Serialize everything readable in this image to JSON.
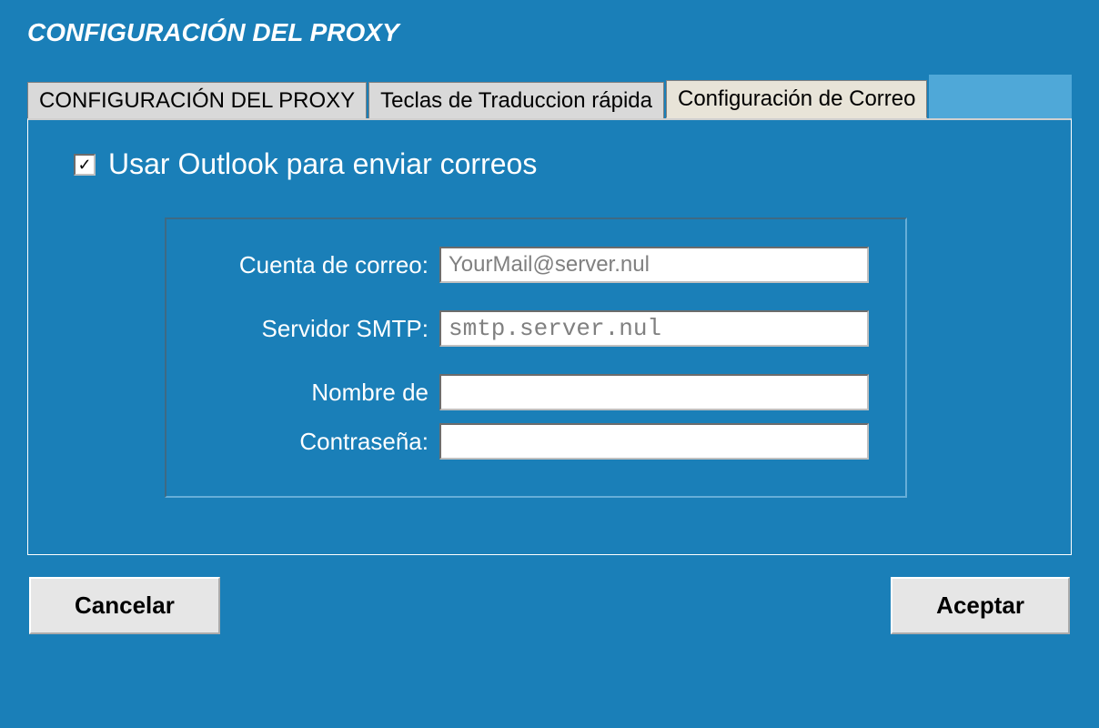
{
  "window": {
    "title": "CONFIGURACIÓN DEL PROXY"
  },
  "tabs": [
    {
      "label": "CONFIGURACIÓN DEL PROXY",
      "active": false
    },
    {
      "label": "Teclas de Traduccion rápida",
      "active": false
    },
    {
      "label": "Configuración de Correo",
      "active": true
    }
  ],
  "mail": {
    "use_outlook_label": "Usar Outlook para enviar correos",
    "use_outlook_checked": true,
    "fields": {
      "account_label": "Cuenta de correo:",
      "account_value": "YourMail@server.nul",
      "smtp_label": "Servidor SMTP:",
      "smtp_value": "smtp.server.nul",
      "username_label": "Nombre de",
      "username_value": "",
      "password_label": "Contraseña:",
      "password_value": ""
    }
  },
  "buttons": {
    "cancel": "Cancelar",
    "accept": "Aceptar"
  }
}
